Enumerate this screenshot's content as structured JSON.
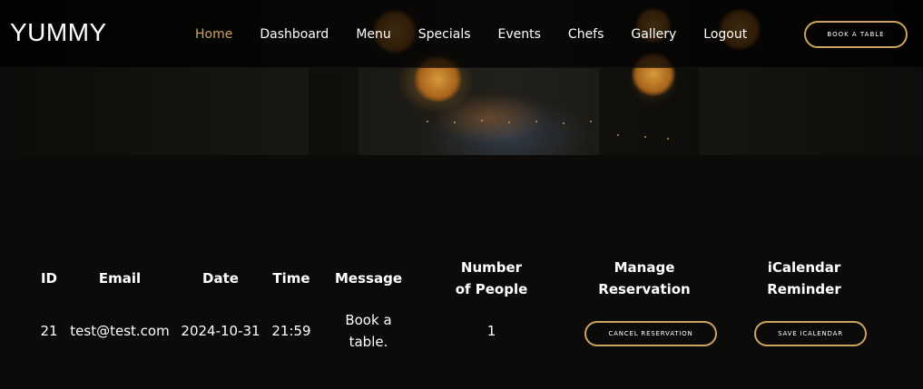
{
  "header": {
    "logo": "YUMMY",
    "nav": [
      {
        "label": "Home",
        "active": true
      },
      {
        "label": "Dashboard"
      },
      {
        "label": "Menu"
      },
      {
        "label": "Specials"
      },
      {
        "label": "Events"
      },
      {
        "label": "Chefs"
      },
      {
        "label": "Gallery"
      },
      {
        "label": "Logout"
      }
    ],
    "book_button": "BOOK A TABLE"
  },
  "reservations": {
    "columns": {
      "id": "ID",
      "email": "Email",
      "date": "Date",
      "time": "Time",
      "message": "Message",
      "people": "Number of People",
      "manage": "Manage Reservation",
      "ical": "iCalendar Reminder"
    },
    "rows": [
      {
        "id": "21",
        "email": "test@test.com",
        "date": "2024-10-31",
        "time": "21:59",
        "message": "Book a table.",
        "people": "1",
        "cancel_label": "CANCEL RESERVATION",
        "ical_label": "SAVE ICALENDAR"
      }
    ]
  },
  "colors": {
    "accent": "#cda45e",
    "background": "#0c0b09",
    "text": "#ffffff"
  }
}
